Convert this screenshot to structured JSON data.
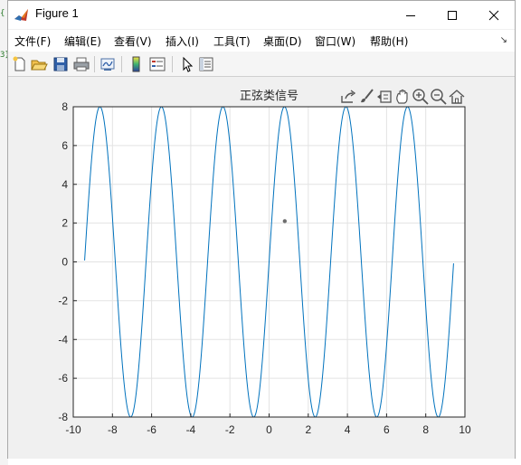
{
  "window": {
    "title": "Figure 1"
  },
  "menu": {
    "items": [
      "文件(F)",
      "编辑(E)",
      "查看(V)",
      "插入(I)",
      "工具(T)",
      "桌面(D)",
      "窗口(W)",
      "帮助(H)"
    ]
  },
  "axes_toolbar": {
    "icons": [
      "export-icon",
      "brush-icon",
      "data-tips-icon",
      "pan-icon",
      "zoom-in-icon",
      "zoom-out-icon",
      "home-icon"
    ]
  },
  "toolbar": {
    "icons": [
      "new-figure-icon",
      "open-file-icon",
      "save-icon",
      "print-icon",
      "link-plot-icon",
      "colorbar-icon",
      "legend-icon",
      "edit-plot-icon",
      "property-inspector-icon"
    ]
  },
  "colors": {
    "line": "#0072bd",
    "axes_bg": "#ffffff",
    "grid": "#e3e3e3",
    "figure_bg": "#f0f0f0"
  },
  "chart_data": {
    "type": "line",
    "title": "正弦类信号",
    "xlabel": "",
    "ylabel": "",
    "xlim": [
      -10,
      10
    ],
    "ylim": [
      -8,
      8
    ],
    "xticks": [
      -10,
      -8,
      -6,
      -4,
      -2,
      0,
      2,
      4,
      6,
      8,
      10
    ],
    "yticks": [
      -8,
      -6,
      -4,
      -2,
      0,
      2,
      4,
      6,
      8
    ],
    "xtick_labels": [
      "-10",
      "-8",
      "-6",
      "-4",
      "-2",
      "0",
      "2",
      "4",
      "6",
      "8",
      "10"
    ],
    "ytick_labels": [
      "-8",
      "-6",
      "-4",
      "-2",
      "0",
      "2",
      "4",
      "6",
      "8"
    ],
    "grid": true,
    "series": [
      {
        "function": "8*sin(2*t)",
        "x_start": -9.42,
        "x_end": 9.42,
        "color": "#0072bd"
      }
    ],
    "marker_point": {
      "x": 0.8,
      "y": 2.1
    }
  }
}
